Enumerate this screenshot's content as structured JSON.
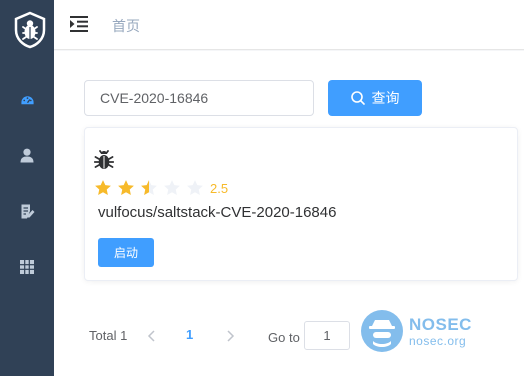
{
  "header": {
    "breadcrumb": "首页"
  },
  "search": {
    "value": "CVE-2020-16846",
    "button_label": "查询"
  },
  "card": {
    "rating": "2.5",
    "rating_value": 2.5,
    "rating_max": 5,
    "title": "vulfocus/saltstack-CVE-2020-16846",
    "start_label": "启动"
  },
  "pagination": {
    "total": "Total 1",
    "current_page": "1",
    "goto_label": "Go to",
    "goto_value": "1"
  },
  "watermark": {
    "name": "NOSEC",
    "url": "nosec.org"
  },
  "colors": {
    "sidebar": "#304156",
    "accent": "#409eff",
    "star_on": "#f7ba2a",
    "star_off": "#eff2f7"
  }
}
